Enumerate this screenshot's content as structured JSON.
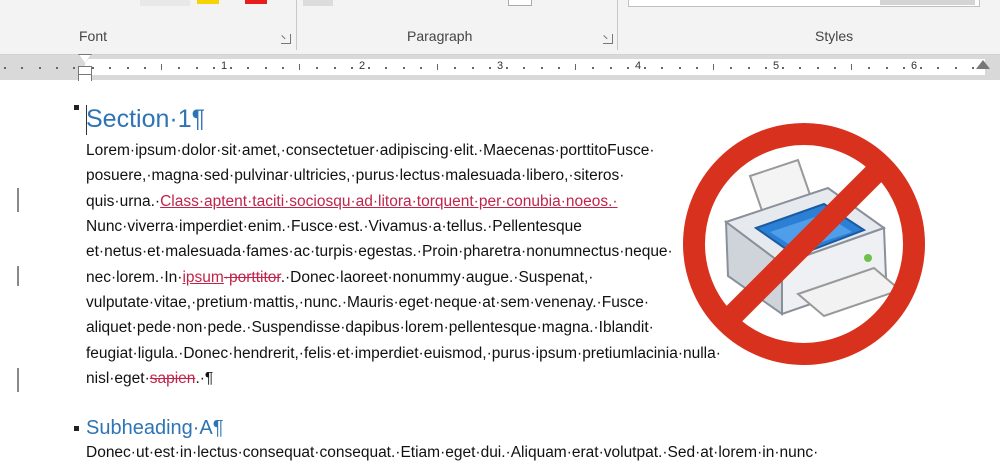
{
  "ribbon": {
    "groups": [
      {
        "label": "Font"
      },
      {
        "label": "Paragraph"
      },
      {
        "label": "Styles"
      }
    ]
  },
  "ruler": {
    "numbers": [
      "1",
      "2",
      "3",
      "4",
      "5",
      "6"
    ]
  },
  "document": {
    "heading1": "Section·1¶",
    "heading2": "Subheading·A¶",
    "lines": [
      {
        "parts": [
          {
            "t": "Lorem·ipsum·dolor·sit·amet,·consectetuer·adipiscing·elit.·Maecenas·porttito",
            "s": "normal"
          },
          {
            "t": "Fusce·",
            "s": "normal"
          }
        ]
      },
      {
        "parts": [
          {
            "t": "posuere,·magna·sed·pulvinar·ultricies,·purus·lectus·malesuada·libero,·sit",
            "s": "normal"
          },
          {
            "t": "eros·",
            "s": "normal"
          }
        ]
      },
      {
        "parts": [
          {
            "t": "quis·urna.·",
            "s": "normal"
          },
          {
            "t": "Class·aptent·taciti·sociosqu·ad·litora·torquent·per·conubia·no",
            "s": "ins"
          },
          {
            "t": "eos.·",
            "s": "ins"
          }
        ]
      },
      {
        "parts": [
          {
            "t": "Nunc·viverra·imperdiet·enim.·Fusce·est.·Vivamus·a·tellus.·Pellentesque",
            "s": "normal"
          }
        ]
      },
      {
        "parts": [
          {
            "t": "et·netus·et·malesuada·fames·ac·turpis·egestas.·Proin·pharetra·nonum",
            "s": "normal"
          },
          {
            "t": "nectus·",
            "s": "normal"
          },
          {
            "t": "neque·",
            "s": "normal"
          }
        ]
      },
      {
        "parts": [
          {
            "t": "nec·lorem.·In·",
            "s": "normal"
          },
          {
            "t": "ipsum",
            "s": "ins"
          },
          {
            "t": "·porttitor",
            "s": "del"
          },
          {
            "t": ".·Donec·laoreet·nonummy·augue.·Suspen",
            "s": "normal"
          },
          {
            "t": "at,·",
            "s": "normal"
          }
        ]
      },
      {
        "parts": [
          {
            "t": "vulputate·vitae,·pretium·mattis,·nunc.·Mauris·eget·neque·at·sem·venena",
            "s": "normal"
          },
          {
            "t": "y.·Fusce·",
            "s": "normal"
          }
        ]
      },
      {
        "parts": [
          {
            "t": "aliquet·pede·non·pede.·Suspendisse·dapibus·lorem·pellentesque·magna.·I",
            "s": "normal"
          },
          {
            "t": "blandit·",
            "s": "normal"
          }
        ]
      },
      {
        "parts": [
          {
            "t": "feugiat·ligula.·Donec·hendrerit,·felis·et·imperdiet·euismod,·purus·ipsum·pretium",
            "s": "normal"
          },
          {
            "t": "lacinia·nulla·",
            "s": "normal"
          }
        ]
      },
      {
        "parts": [
          {
            "t": "nisl·eget·",
            "s": "normal"
          },
          {
            "t": "sapien",
            "s": "del"
          },
          {
            "t": ".·¶",
            "s": "normal"
          }
        ]
      },
      {
        "parts": [
          {
            "t": "Donec·ut·est·in·lectus·consequat·consequat.·Etiam·eget·dui.·Aliquam·erat·volutpat.·Sed·at·lorem·in·nunc·",
            "s": "normal"
          }
        ]
      }
    ]
  },
  "overlay": {
    "icon": "no-printing-icon",
    "ring_color": "#d8321e",
    "printer_accent": "#2b7fd4"
  }
}
